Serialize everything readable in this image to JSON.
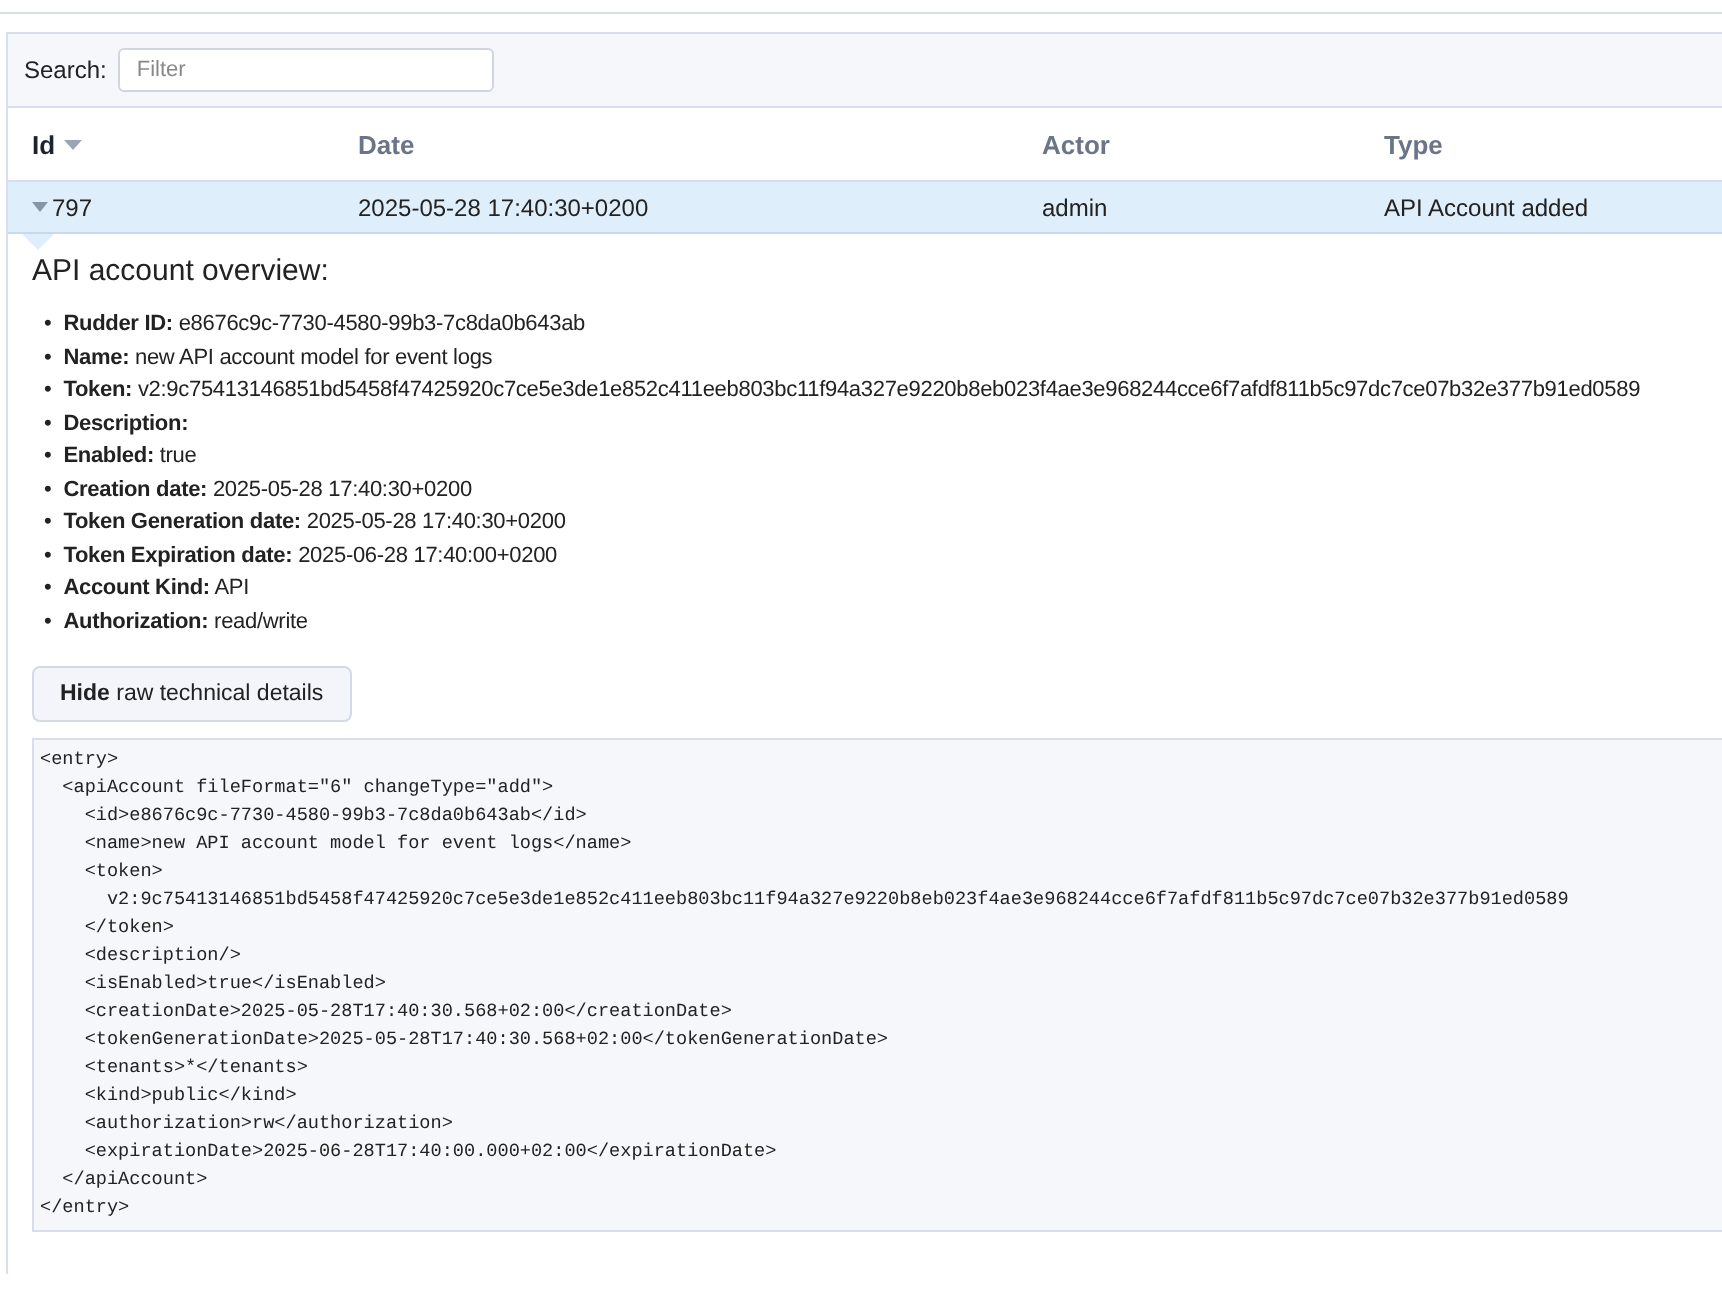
{
  "search": {
    "label": "Search:",
    "placeholder": "Filter"
  },
  "table": {
    "columns": [
      {
        "label": "Id",
        "sorted": true
      },
      {
        "label": "Date",
        "sorted": false
      },
      {
        "label": "Actor",
        "sorted": false
      },
      {
        "label": "Type",
        "sorted": false
      }
    ],
    "rows": [
      {
        "cells": [
          "797",
          "2025-05-28 17:40:30+0200",
          "admin",
          "API Account added"
        ],
        "selected": true,
        "expanded": true
      }
    ]
  },
  "details": {
    "title": "API account overview:",
    "fields": [
      {
        "bullet": "•",
        "label": "Rudder ID:",
        "value": "e8676c9c-7730-4580-99b3-7c8da0b643ab"
      },
      {
        "bullet": "•",
        "label": "Name:",
        "value": "new API account model for event logs"
      },
      {
        "bullet": "•",
        "label": "Token:",
        "value": "v2:9c75413146851bd5458f47425920c7ce5e3de1e852c411eeb803bc11f94a327e9220b8eb023f4ae3e968244cce6f7afdf811b5c97dc7ce07b32e377b91ed0589"
      },
      {
        "bullet": "•",
        "label": "Description:"
      },
      {
        "bullet": "•",
        "label": "Enabled:",
        "value": "true"
      },
      {
        "bullet": "•",
        "label": "Creation date:",
        "value": "2025-05-28 17:40:30+0200"
      },
      {
        "bullet": "•",
        "label": "Token Generation date:",
        "value": "2025-05-28 17:40:30+0200"
      },
      {
        "bullet": "•",
        "label": "Token Expiration date:",
        "value": "2025-06-28 17:40:00+0200"
      },
      {
        "bullet": "•",
        "label": "Account Kind:",
        "value": "API"
      },
      {
        "bullet": "•",
        "label": "Authorization:",
        "value": "read/write"
      }
    ],
    "toggle_button": "**Hide** raw technical details",
    "raw_xml": "<entry>\n  <apiAccount fileFormat=\"6\" changeType=\"add\">\n    <id>e8676c9c-7730-4580-99b3-7c8da0b643ab</id>\n    <name>new API account model for event logs</name>\n    <token>\n      v2:9c75413146851bd5458f47425920c7ce5e3de1e852c411eeb803bc11f94a327e9220b8eb023f4ae3e968244cce6f7afdf811b5c97dc7ce07b32e377b91ed0589\n    </token>\n    <description/>\n    <isEnabled>true</isEnabled>\n    <creationDate>2025-05-28T17:40:30.568+02:00</creationDate>\n    <tokenGenerationDate>2025-05-28T17:40:30.568+02:00</tokenGenerationDate>\n    <tenants>*</tenants>\n    <kind>public</kind>\n    <authorization>rw</authorization>\n    <expirationDate>2025-06-28T17:40:00.000+02:00</expirationDate>\n  </apiAccount>\n</entry>"
  }
}
